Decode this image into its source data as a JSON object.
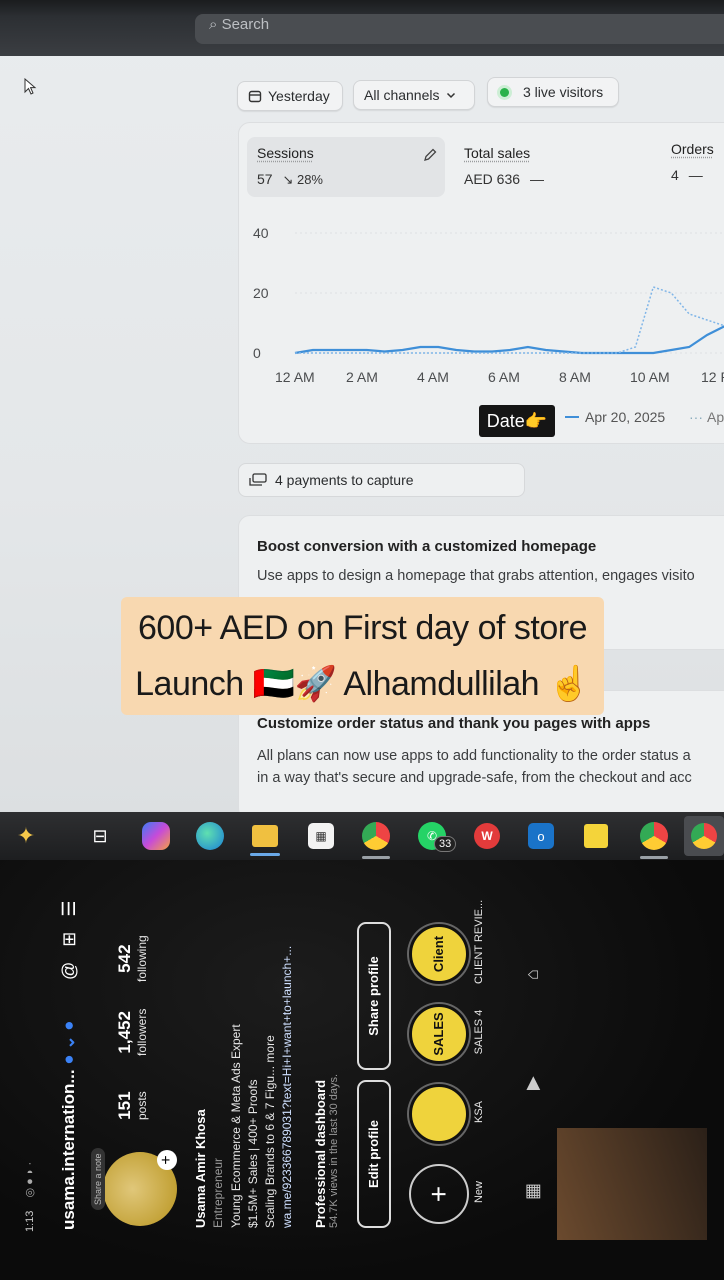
{
  "topbar": {
    "search_placeholder": "Search"
  },
  "filters": {
    "date_label": "Yesterday",
    "channels_label": "All channels",
    "visitors_label": "3 live visitors"
  },
  "metrics": {
    "sessions": {
      "label": "Sessions",
      "value": "57",
      "change": "↘ 28%"
    },
    "total_sales": {
      "label": "Total sales",
      "value": "AED 636",
      "change": "—"
    },
    "orders": {
      "label": "Orders",
      "value": "4",
      "change": "—"
    }
  },
  "chart_data": {
    "type": "line",
    "y_ticks": [
      "40",
      "20",
      "0"
    ],
    "x_ticks": [
      "12 AM",
      "2 AM",
      "4 AM",
      "6 AM",
      "8 AM",
      "10 AM",
      "12 P"
    ],
    "ylim": [
      0,
      40
    ],
    "series": [
      {
        "name": "Apr 20, 2025",
        "style": "solid",
        "color": "#3f8fd8",
        "x": [
          0,
          1,
          2,
          3,
          4,
          5,
          6,
          7,
          8,
          9,
          10,
          11,
          12,
          13,
          14,
          15,
          16,
          17,
          18,
          19,
          20,
          21,
          22,
          23,
          24
        ],
        "values": [
          0,
          1,
          1,
          1,
          1,
          0.5,
          1,
          2,
          2,
          1,
          0.5,
          0.5,
          1,
          2,
          1,
          0.5,
          0,
          0,
          0,
          0,
          0,
          1,
          2,
          6,
          9
        ]
      },
      {
        "name": "Ap",
        "style": "dotted",
        "color": "#7fb5e8",
        "x": [
          0,
          1,
          2,
          3,
          4,
          5,
          6,
          7,
          8,
          9,
          10,
          11,
          12,
          13,
          14,
          15,
          16,
          17,
          18,
          19,
          20,
          21,
          22,
          23,
          24
        ],
        "values": [
          0,
          0,
          0,
          0,
          0,
          0,
          0,
          0,
          0,
          0,
          0,
          0,
          0,
          0,
          0,
          0,
          0,
          0,
          0,
          2,
          22,
          20,
          13,
          11,
          9
        ]
      }
    ],
    "legend": {
      "tag": "Date👉",
      "primary": "Apr 20, 2025",
      "secondary": "Ap"
    }
  },
  "payments": {
    "label": "4 payments to capture"
  },
  "boost": {
    "title": "Boost conversion with a customized homepage",
    "desc": "Use apps to design a homepage that grabs attention, engages visito"
  },
  "status_card": {
    "title": "Customize order status and thank you pages with apps",
    "desc_line1": "All plans can now use apps to add functionality to the order status a",
    "desc_line2": "in a way that's secure and upgrade-safe, from the checkout and acc"
  },
  "caption": {
    "line1": "600+ AED on First day of store",
    "line2": "Launch 🇦🇪🚀 Alhamdullilah ☝️"
  },
  "taskbar": {
    "whatsapp_badge": "33"
  },
  "profile": {
    "status_time": "1:13",
    "username": "usama.internation...",
    "posts_count": "151",
    "posts_label": "posts",
    "followers_count": "1,452",
    "followers_label": "followers",
    "following_count": "542",
    "following_label": "following",
    "name": "Usama Amir Khosa",
    "category": "Entrepreneur",
    "bio1": "Young Ecommerce & Meta Ads Expert",
    "bio2": "$1.5M+ Sales | 400+ Proofs",
    "bio3": "Scaling Brands to 6 & 7 Figu... more",
    "link": "wa.me/923366789031?text=Hi+I+want+to+launch+...",
    "dashboard_title": "Professional dashboard",
    "dashboard_sub": "54.7K views in the last 30 days.",
    "edit_button": "Edit profile",
    "share_button": "Share profile",
    "share_note": "Share a note",
    "highlights": [
      {
        "label": "New",
        "cover": "+"
      },
      {
        "label": "KSA",
        "cover": ""
      },
      {
        "label": "SALES 4",
        "cover": "SALES"
      },
      {
        "label": "CLIENT REVIE...",
        "cover": "Client"
      }
    ]
  }
}
